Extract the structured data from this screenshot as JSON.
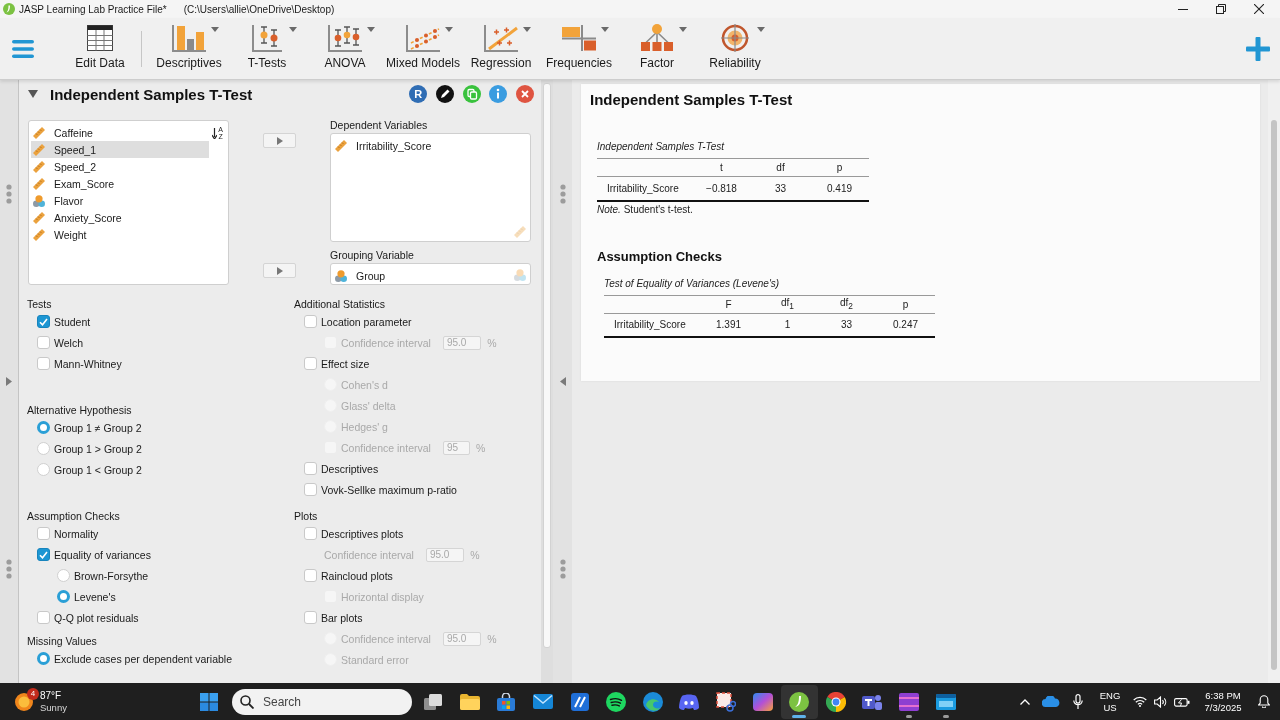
{
  "window": {
    "title": "JASP Learning Lab Practice File*",
    "path": "(C:\\Users\\allie\\OneDrive\\Desktop)"
  },
  "ribbon": {
    "items": [
      {
        "kind": "edit-data",
        "label": "Edit Data",
        "dropdown": false
      },
      {
        "kind": "descriptives",
        "label": "Descriptives",
        "dropdown": true
      },
      {
        "kind": "t-tests",
        "label": "T-Tests",
        "dropdown": true
      },
      {
        "kind": "anova",
        "label": "ANOVA",
        "dropdown": true
      },
      {
        "kind": "mixed-models",
        "label": "Mixed Models",
        "dropdown": true
      },
      {
        "kind": "regression",
        "label": "Regression",
        "dropdown": true
      },
      {
        "kind": "frequencies",
        "label": "Frequencies",
        "dropdown": true
      },
      {
        "kind": "factor",
        "label": "Factor",
        "dropdown": true
      },
      {
        "kind": "reliability",
        "label": "Reliability",
        "dropdown": true
      }
    ]
  },
  "analysis": {
    "title": "Independent Samples T-Test",
    "expanded": true,
    "header_buttons": [
      {
        "kind": "r-syntax",
        "label": "R"
      },
      {
        "kind": "edit"
      },
      {
        "kind": "duplicate"
      },
      {
        "kind": "info"
      },
      {
        "kind": "close"
      }
    ],
    "sort": {
      "top": "A",
      "bottom": "Z"
    },
    "variables": [
      {
        "name": "Caffeine",
        "kind": "scale",
        "selected": false
      },
      {
        "name": "Speed_1",
        "kind": "scale",
        "selected": true
      },
      {
        "name": "Speed_2",
        "kind": "scale",
        "selected": false
      },
      {
        "name": "Exam_Score",
        "kind": "scale",
        "selected": false
      },
      {
        "name": "Flavor",
        "kind": "nominal",
        "selected": false
      },
      {
        "name": "Anxiety_Score",
        "kind": "scale",
        "selected": false
      },
      {
        "name": "Weight",
        "kind": "scale",
        "selected": false
      }
    ],
    "targets": [
      {
        "label": "Dependent Variables",
        "kind": "scale",
        "variables": [
          {
            "name": "Irritability_Score",
            "kind": "scale"
          }
        ]
      },
      {
        "label": "Grouping Variable",
        "kind": "nominal",
        "variables": [
          {
            "name": "Group",
            "kind": "nominal"
          }
        ]
      }
    ],
    "option_rows": [
      {
        "left": [
          {
            "title": "Tests",
            "items": [
              {
                "kind": "checkbox",
                "label": "Student",
                "checked": true,
                "disabled": false
              },
              {
                "kind": "checkbox",
                "label": "Welch",
                "checked": false,
                "disabled": false
              },
              {
                "kind": "checkbox",
                "label": "Mann-Whitney",
                "checked": false,
                "disabled": false
              }
            ]
          },
          {
            "title": "Alternative Hypothesis",
            "items": [
              {
                "kind": "radio",
                "label": "Group 1 ≠ Group 2",
                "selected": true,
                "disabled": false
              },
              {
                "kind": "radio",
                "label": "Group 1 > Group 2",
                "selected": false,
                "disabled": false
              },
              {
                "kind": "radio",
                "label": "Group 1 < Group 2",
                "selected": false,
                "disabled": false
              }
            ]
          }
        ],
        "right": [
          {
            "title": "Additional Statistics",
            "items": [
              {
                "kind": "checkbox",
                "label": "Location parameter",
                "checked": false,
                "disabled": false,
                "children": [
                  {
                    "kind": "checkbox",
                    "label": "Confidence interval",
                    "checked": false,
                    "disabled": true,
                    "value": "95.0",
                    "unit": "%"
                  }
                ]
              },
              {
                "kind": "checkbox",
                "label": "Effect size",
                "checked": false,
                "disabled": false,
                "children": [
                  {
                    "kind": "radio",
                    "label": "Cohen's d",
                    "selected": false,
                    "disabled": true
                  },
                  {
                    "kind": "radio",
                    "label": "Glass' delta",
                    "selected": false,
                    "disabled": true
                  },
                  {
                    "kind": "radio",
                    "label": "Hedges' g",
                    "selected": false,
                    "disabled": true
                  },
                  {
                    "kind": "checkbox",
                    "label": "Confidence interval",
                    "checked": false,
                    "disabled": true,
                    "value": "95",
                    "unit": "%"
                  }
                ]
              },
              {
                "kind": "checkbox",
                "label": "Descriptives",
                "checked": false,
                "disabled": false
              },
              {
                "kind": "checkbox",
                "label": "Vovk-Sellke maximum p-ratio",
                "checked": false,
                "disabled": false
              }
            ]
          }
        ]
      },
      {
        "left": [
          {
            "title": "Assumption Checks",
            "items": [
              {
                "kind": "checkbox",
                "label": "Normality",
                "checked": false,
                "disabled": false
              },
              {
                "kind": "checkbox",
                "label": "Equality of variances",
                "checked": true,
                "disabled": false,
                "children": [
                  {
                    "kind": "radio",
                    "label": "Brown-Forsythe",
                    "selected": false,
                    "disabled": false
                  },
                  {
                    "kind": "radio",
                    "label": "Levene's",
                    "selected": true,
                    "disabled": false
                  }
                ]
              },
              {
                "kind": "checkbox",
                "label": "Q-Q plot residuals",
                "checked": false,
                "disabled": false
              }
            ]
          },
          {
            "title": "Missing Values",
            "items": [
              {
                "kind": "radio",
                "label": "Exclude cases per dependent variable",
                "selected": true,
                "disabled": false
              }
            ]
          }
        ],
        "right": [
          {
            "title": "Plots",
            "items": [
              {
                "kind": "checkbox",
                "label": "Descriptives plots",
                "checked": false,
                "disabled": false,
                "children": [
                  {
                    "kind": "field",
                    "label": "Confidence interval",
                    "disabled": true,
                    "value": "95.0",
                    "unit": "%"
                  }
                ]
              },
              {
                "kind": "checkbox",
                "label": "Raincloud plots",
                "checked": false,
                "disabled": false,
                "children": [
                  {
                    "kind": "checkbox",
                    "label": "Horizontal display",
                    "checked": false,
                    "disabled": true
                  }
                ]
              },
              {
                "kind": "checkbox",
                "label": "Bar plots",
                "checked": false,
                "disabled": false,
                "children": [
                  {
                    "kind": "radio",
                    "label": "Confidence interval",
                    "selected": false,
                    "disabled": true,
                    "value": "95.0",
                    "unit": "%"
                  },
                  {
                    "kind": "radio",
                    "label": "Standard error",
                    "selected": false,
                    "disabled": true
                  }
                ]
              }
            ]
          }
        ]
      }
    ]
  },
  "results": {
    "title": "Independent Samples T-Test",
    "tables": [
      {
        "caption": "Independent Samples T-Test",
        "columns": [
          "t",
          "df",
          "p"
        ],
        "rows": [
          {
            "label": "Irritability_Score",
            "cells": [
              "−0.818",
              "33",
              "0.419"
            ]
          }
        ],
        "note": "*Note.* Student's t-test."
      }
    ],
    "subsections": [
      {
        "title": "Assumption Checks",
        "tables": [
          {
            "caption": "Test of Equality of Variances (Levene's)",
            "columns": [
              "F",
              "df$_{1}$",
              "df$_{2}$",
              "p"
            ],
            "rows": [
              {
                "label": "Irritability_Score",
                "cells": [
                  "1.391",
                  "1",
                  "33",
                  "0.247"
                ]
              }
            ]
          }
        ]
      }
    ]
  },
  "taskbar": {
    "weather": {
      "badge": "4",
      "temperature": "87°F",
      "condition": "Sunny"
    },
    "search": {
      "placeholder": "Search"
    },
    "apps": [
      {
        "kind": "task-view",
        "open": false,
        "selected": false
      },
      {
        "kind": "file-explorer",
        "open": false,
        "selected": false
      },
      {
        "kind": "store",
        "open": false,
        "selected": false
      },
      {
        "kind": "mail",
        "open": false,
        "selected": false
      },
      {
        "kind": "slash-app",
        "open": false,
        "selected": false
      },
      {
        "kind": "spotify",
        "open": false,
        "selected": false
      },
      {
        "kind": "edge",
        "open": false,
        "selected": false
      },
      {
        "kind": "discord",
        "open": false,
        "selected": false
      },
      {
        "kind": "snipping",
        "open": false,
        "selected": false
      },
      {
        "kind": "m365",
        "open": false,
        "selected": false
      },
      {
        "kind": "jasp",
        "open": true,
        "selected": true
      },
      {
        "kind": "chrome",
        "open": false,
        "selected": false
      },
      {
        "kind": "teams",
        "open": false,
        "selected": false
      },
      {
        "kind": "video-editor",
        "open": true,
        "selected": false
      },
      {
        "kind": "window-app",
        "open": true,
        "selected": false
      }
    ],
    "tray": {
      "language": "ENG",
      "region": "US",
      "time": "6:38 PM",
      "date": "7/3/2025"
    }
  }
}
